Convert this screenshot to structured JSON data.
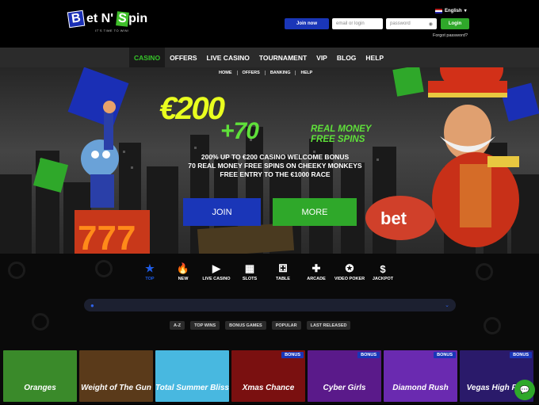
{
  "header": {
    "logo_text": "Bet N' Spin",
    "logo_b": "B",
    "logo_et": "et N'",
    "logo_s": "S",
    "logo_pin": "pin",
    "tagline": "IT'S TIME TO WIN!",
    "language": "English",
    "join_label": "Join now",
    "email_placeholder": "email or login",
    "password_placeholder": "password",
    "login_label": "Login",
    "forgot_label": "Forgot password?"
  },
  "nav": {
    "items": [
      {
        "label": "CASINO",
        "active": true
      },
      {
        "label": "OFFERS"
      },
      {
        "label": "LIVE CASINO"
      },
      {
        "label": "TOURNAMENT"
      },
      {
        "label": "VIP"
      },
      {
        "label": "BLOG"
      },
      {
        "label": "HELP"
      }
    ]
  },
  "subnav": [
    "HOME",
    "OFFERS",
    "BANKING",
    "HELP"
  ],
  "hero": {
    "amount": "€200",
    "plus_spins": "+70",
    "real_money_line1": "REAL MONEY",
    "real_money_line2": "FREE SPINS",
    "line1": "200% UP TO €200 CASINO WELCOME BONUS",
    "line2": "70 REAL MONEY FREE SPINS ON CHEEKY MONKEYS",
    "line3": "FREE ENTRY TO THE €1000 RACE",
    "join_label": "JOIN",
    "more_label": "MORE"
  },
  "categories": [
    {
      "label": "TOP",
      "icon": "star-icon",
      "active": true
    },
    {
      "label": "NEW",
      "icon": "flame-icon"
    },
    {
      "label": "LIVE CASINO",
      "icon": "play-icon"
    },
    {
      "label": "SLOTS",
      "icon": "slot-machine-icon"
    },
    {
      "label": "TABLE",
      "icon": "dice-icon"
    },
    {
      "label": "ARCADE",
      "icon": "gamepad-icon"
    },
    {
      "label": "VIDEO POKER",
      "icon": "poker-chip-icon"
    },
    {
      "label": "JACKPOT",
      "icon": "dollar-icon"
    }
  ],
  "filters": [
    "A-Z",
    "TOP WINS",
    "BONUS GAMES",
    "POPULAR",
    "LAST RELEASED"
  ],
  "games": [
    {
      "title": "Oranges",
      "badge": "",
      "bg": "#3a8a2a"
    },
    {
      "title": "Weight of The Gun",
      "badge": "",
      "bg": "#5a3a1a"
    },
    {
      "title": "Total Summer Bliss",
      "badge": "",
      "bg": "#48b8e0"
    },
    {
      "title": "Xmas Chance",
      "badge": "BONUS",
      "bg": "#7a1010"
    },
    {
      "title": "Cyber Girls",
      "badge": "BONUS",
      "bg": "#5a1a8a"
    },
    {
      "title": "Diamond Rush",
      "badge": "BONUS",
      "bg": "#6a2ab0"
    },
    {
      "title": "Vegas High Roll",
      "badge": "BONUS",
      "bg": "#2a1a6a"
    }
  ],
  "colors": {
    "brand_blue": "#1a36b8",
    "brand_green": "#2fa82a",
    "nav_active": "#36c42a"
  }
}
